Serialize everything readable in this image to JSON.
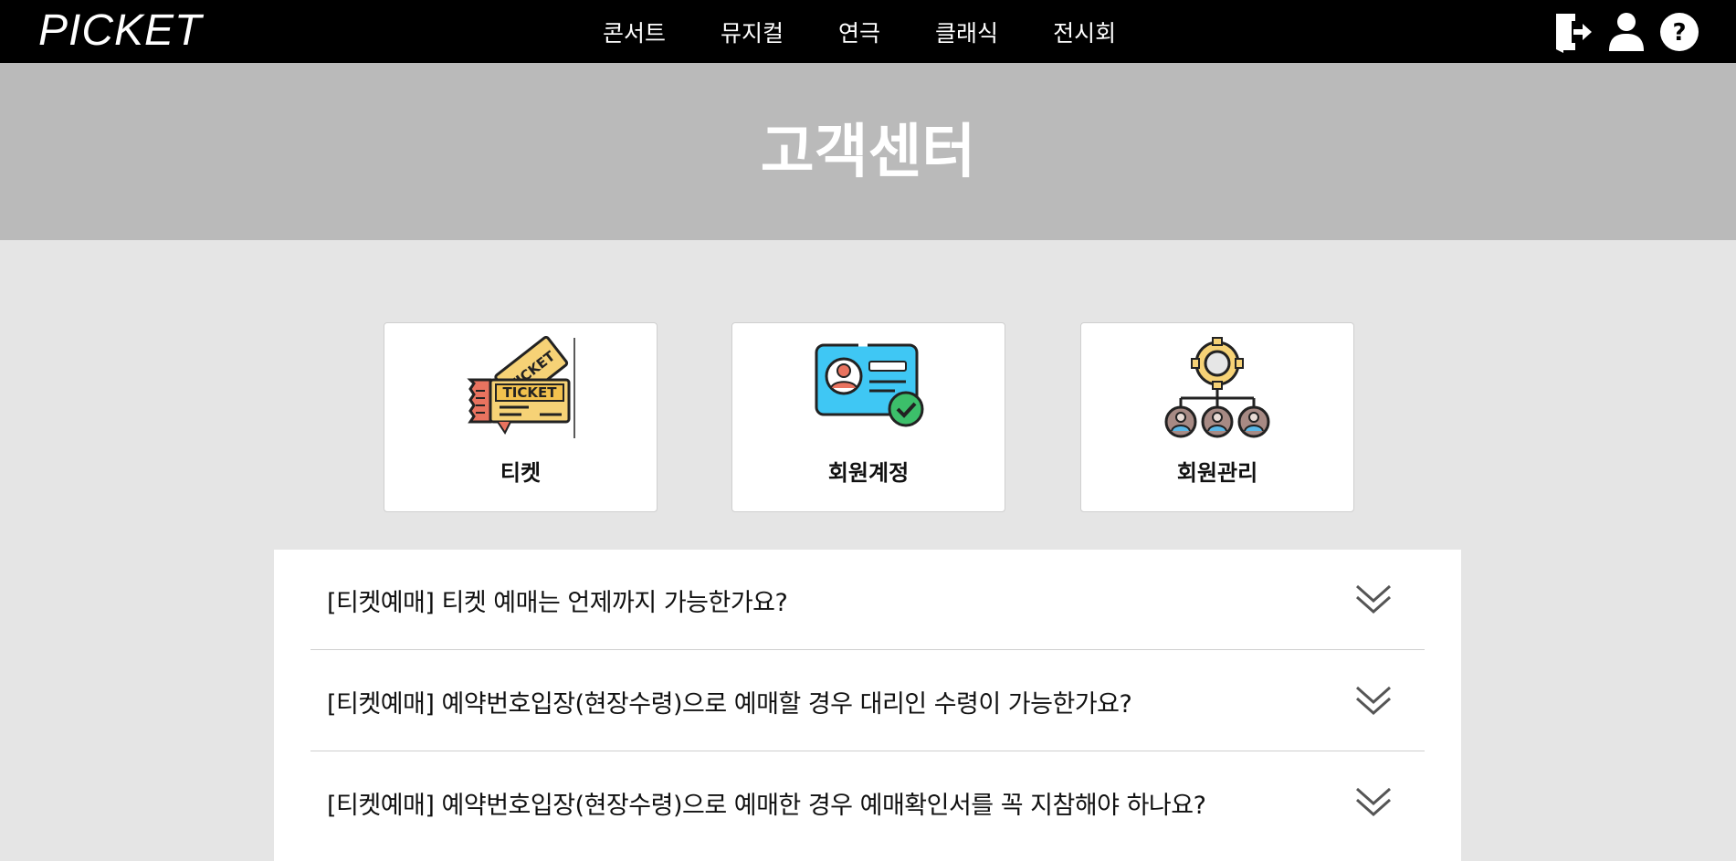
{
  "header": {
    "logo": "PICKET",
    "menu": [
      "콘서트",
      "뮤지컬",
      "연극",
      "클래식",
      "전시회"
    ],
    "icons": [
      "logout-icon",
      "user-icon",
      "help-icon"
    ]
  },
  "banner": {
    "title": "고객센터"
  },
  "categories": [
    {
      "label": "티켓",
      "icon": "ticket-icon"
    },
    {
      "label": "회원계정",
      "icon": "member-card-icon"
    },
    {
      "label": "회원관리",
      "icon": "member-management-icon"
    }
  ],
  "faq": [
    {
      "question": "[티켓예매] 티켓 예매는 언제까지 가능한가요?"
    },
    {
      "question": "[티켓예매] 예약번호입장(현장수령)으로 예매할 경우 대리인 수령이 가능한가요?"
    },
    {
      "question": "[티켓예매] 예약번호입장(현장수령)으로 예매한 경우 예매확인서를 꼭 지참해야 하나요?"
    }
  ],
  "colors": {
    "nav_bg": "#000000",
    "banner_bg": "#bababa",
    "page_bg": "#e5e5e5",
    "ticket_yellow": "#f6d276",
    "ticket_red": "#e9735f",
    "card_blue": "#3fc7f4",
    "check_green": "#3cbf6a",
    "gear_yellow": "#f6d276"
  }
}
